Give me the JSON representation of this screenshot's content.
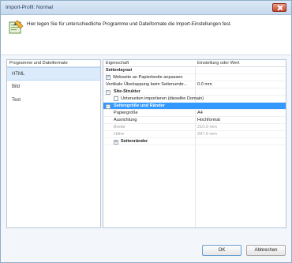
{
  "window": {
    "title": "Import-Profil: Normal"
  },
  "header": {
    "text": "Hier legen Sie für unterschiedliche Programme und Dateiformate die Import-Einstellungen fest."
  },
  "left_panel": {
    "header": "Programme und Dateiformate",
    "items": [
      {
        "label": "HTML",
        "selected": true
      },
      {
        "label": "Bild",
        "selected": false
      },
      {
        "label": "Text",
        "selected": false
      }
    ]
  },
  "properties": {
    "col_property": "Eigenschaft",
    "col_value": "Einstellung oder Wert",
    "rows": [
      {
        "label": "Seitenlayout",
        "value": ""
      },
      {
        "label": "Webseite an Papierbreite anpassen",
        "value": "",
        "checked": true
      },
      {
        "label": "Vertikale Überlappung beim Seitenumbr...",
        "value": "0.0 mm"
      },
      {
        "label": "Site-Struktur",
        "value": "",
        "toggle": "−"
      },
      {
        "label": "Unterseiten importieren (dieselbe Domain)",
        "value": "",
        "checked": false
      },
      {
        "label": "Seitengröße und Ränder",
        "value": "",
        "toggle": "−"
      },
      {
        "label": "Papiergröße",
        "value": "A4"
      },
      {
        "label": "Ausrichtung",
        "value": "Hochformat"
      },
      {
        "label": "Breite",
        "value": "210.0 mm"
      },
      {
        "label": "Höhe",
        "value": "297.0 mm"
      },
      {
        "label": "Seitenränder",
        "value": "",
        "toggle": "+"
      }
    ]
  },
  "buttons": {
    "ok": "OK",
    "cancel": "Abbrechen"
  },
  "colors": {
    "selection": "#3399ff",
    "list_selection": "#dcebfc",
    "titlebar": "#c7d9ee"
  }
}
